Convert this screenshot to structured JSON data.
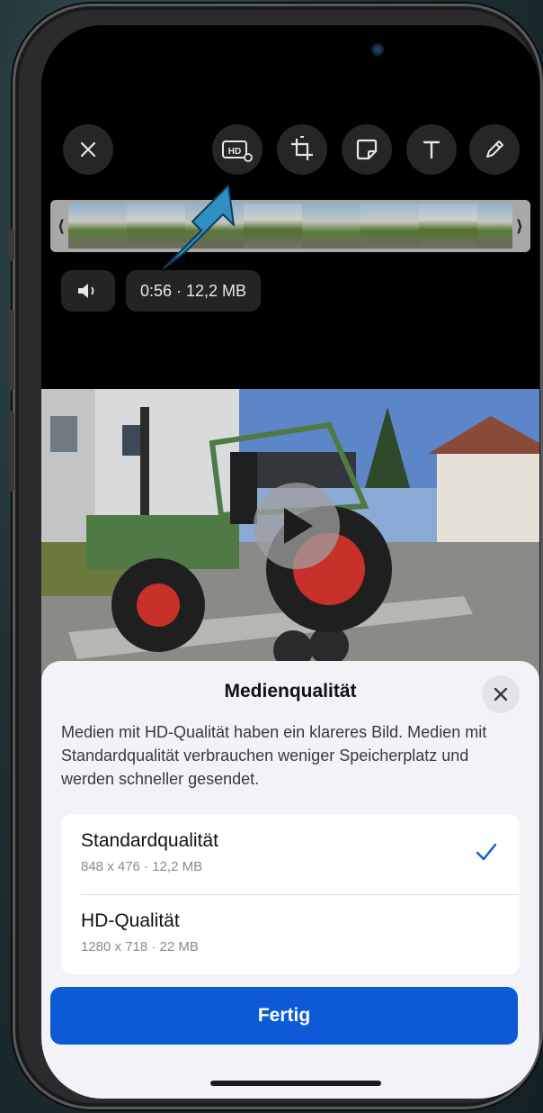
{
  "toolbar": {
    "close_icon": "close-icon",
    "hd_icon": "hd-quality-icon",
    "crop_icon": "crop-rotate-icon",
    "sticker_icon": "sticker-icon",
    "text_icon": "text-icon",
    "draw_icon": "pencil-icon"
  },
  "video_info": {
    "mute_icon": "speaker-icon",
    "duration_size": "0:56 · 12,2 MB"
  },
  "sheet": {
    "title": "Medienqualität",
    "description": "Medien mit HD-Qualität haben ein klareres Bild. Medien mit Standardqualität verbrauchen weniger Speicherplatz und werden schneller gesendet.",
    "options": [
      {
        "label": "Standardqualität",
        "details": "848 x 476 · 12,2 MB",
        "selected": true
      },
      {
        "label": "HD-Qualität",
        "details": "1280 x 718 · 22 MB",
        "selected": false
      }
    ],
    "done_label": "Fertig"
  },
  "colors": {
    "accent": "#0d5ad6",
    "annotation_arrow": "#2f8fc0",
    "sheet_bg": "#f2f2f7"
  }
}
